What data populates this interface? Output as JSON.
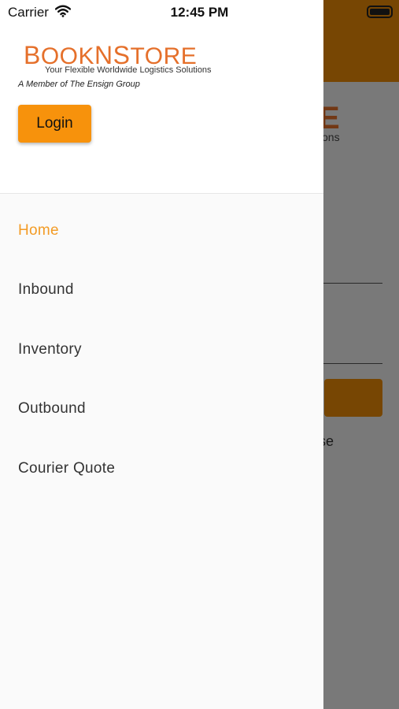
{
  "status_bar": {
    "carrier": "Carrier",
    "time": "12:45 PM"
  },
  "background": {
    "logo_fragment": "E",
    "tagline_fragment": "tions",
    "text_fragment": "se"
  },
  "drawer": {
    "logo": {
      "word": "BookNStore",
      "tagline": "Your Flexible Worldwide Logistics Solutions"
    },
    "member_text": "A Member of The Ensign Group",
    "login_label": "Login",
    "menu_items": [
      {
        "label": "Home",
        "active": true
      },
      {
        "label": "Inbound",
        "active": false
      },
      {
        "label": "Inventory",
        "active": false
      },
      {
        "label": "Outbound",
        "active": false
      },
      {
        "label": "Courier Quote",
        "active": false
      }
    ]
  },
  "colors": {
    "brand_orange": "#f7920c",
    "logo_orange": "#e5702b",
    "active_menu": "#f39b25"
  }
}
